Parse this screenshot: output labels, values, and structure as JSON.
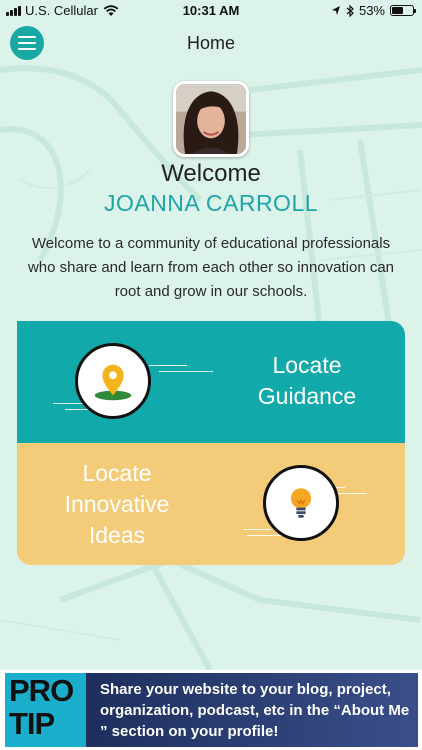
{
  "status_bar": {
    "carrier": "U.S. Cellular",
    "time": "10:31 AM",
    "battery": "53%",
    "battery_level": 0.53
  },
  "header": {
    "title": "Home"
  },
  "profile": {
    "welcome": "Welcome",
    "name": "JOANNA CARROLL"
  },
  "intro_text": "Welcome to a community of educational professionals who share and learn from each other so innovation can root and grow in our schools.",
  "cards": {
    "guidance": {
      "label_line1": "Locate",
      "label_line2": "Guidance",
      "icon": "map-pin-icon"
    },
    "ideas": {
      "label_line1": "Locate",
      "label_line2": "Innovative",
      "label_line3": "Ideas",
      "icon": "lightbulb-icon"
    }
  },
  "banner": {
    "badge_line1": "PRO",
    "badge_line2": "TIP",
    "text": "Share your website to your blog, project, organization, podcast, etc in the “About Me ” section on your profile!"
  },
  "colors": {
    "accent": "#1aa8a4",
    "teal_card": "#12a9aa",
    "yellow_card": "#f4cb79",
    "background": "#dcf3ea"
  }
}
